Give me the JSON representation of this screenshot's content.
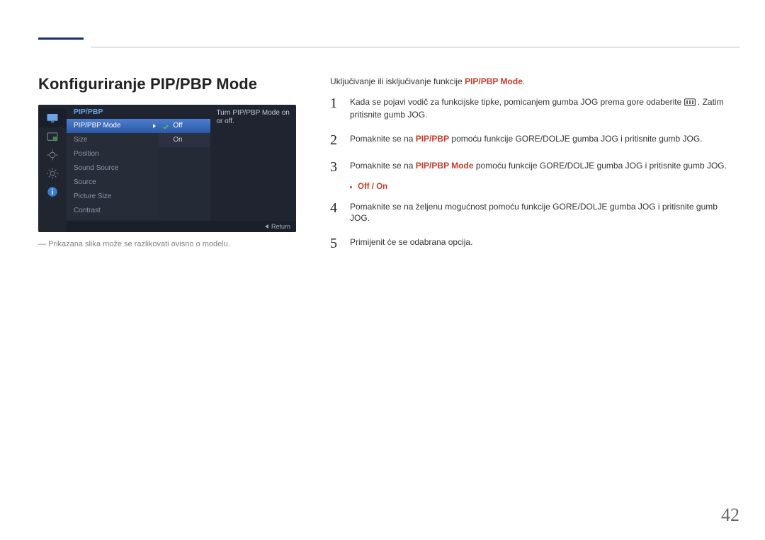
{
  "page": {
    "number": "42"
  },
  "title": "Konfiguriranje PIP/PBP Mode",
  "footnote": "Prikazana slika može se razlikovati ovisno o modelu.",
  "osd": {
    "header": "PIP/PBP",
    "items": [
      "PIP/PBP Mode",
      "Size",
      "Position",
      "Sound Source",
      "Source",
      "Picture Size",
      "Contrast"
    ],
    "values": [
      "Off",
      "On"
    ],
    "help": "Turn PIP/PBP Mode on or off.",
    "return": "Return"
  },
  "intro_prefix": "Uključivanje ili isključivanje funkcije ",
  "intro_hl": "PIP/PBP Mode",
  "intro_suffix": ".",
  "steps": {
    "s1_a": "Kada se pojavi vodič za funkcijske tipke, pomicanjem gumba JOG prema gore odaberite ",
    "s1_b": ". Zatim pritisnite gumb JOG.",
    "s2_a": "Pomaknite se na ",
    "s2_hl": "PIP/PBP",
    "s2_b": " pomoću funkcije GORE/DOLJE gumba JOG i pritisnite gumb JOG.",
    "s3_a": "Pomaknite se na ",
    "s3_hl": "PIP/PBP Mode",
    "s3_b": " pomoću funkcije GORE/DOLJE gumba JOG i pritisnite gumb JOG.",
    "bullet": "Off / On",
    "s4": "Pomaknite se na željenu mogućnost pomoću funkcije GORE/DOLJE gumba JOG i pritisnite gumb JOG.",
    "s5": "Primijenit će se odabrana opcija."
  },
  "nums": {
    "n1": "1",
    "n2": "2",
    "n3": "3",
    "n4": "4",
    "n5": "5"
  }
}
